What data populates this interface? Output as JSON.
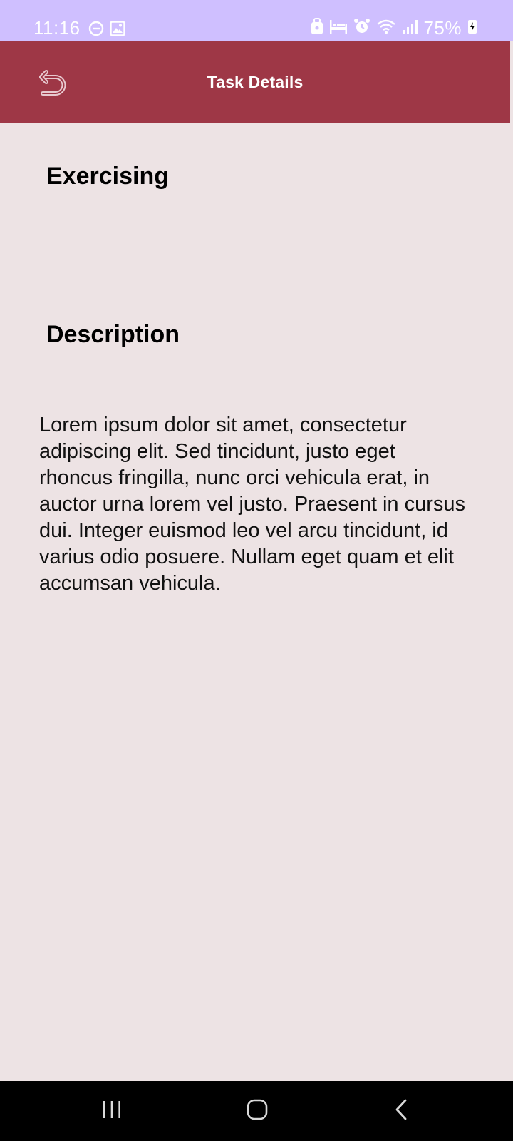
{
  "status_bar": {
    "time": "11:16",
    "battery_percent": "75%",
    "left_icons": [
      "do-not-disturb-icon",
      "image-icon"
    ],
    "right_icons": [
      "lock-icon",
      "bed-icon",
      "alarm-icon",
      "wifi-icon",
      "signal-icon",
      "battery-charging-icon"
    ],
    "background": "#cfbfff"
  },
  "app_bar": {
    "title": "Task Details",
    "back_icon": "back-arrow-icon",
    "background": "#9e3746"
  },
  "task": {
    "title": "Exercising",
    "description_heading": "Description",
    "description": "Lorem ipsum dolor sit amet, consectetur adipiscing elit. Sed tincidunt, justo eget rhoncus fringilla, nunc orci vehicula erat, in auctor urna lorem vel justo. Praesent in cursus dui. Integer euismod leo vel arcu tincidunt, id varius odio posuere. Nullam eget quam et elit accumsan vehicula."
  },
  "nav_bar": {
    "buttons": [
      "recent-apps-icon",
      "home-icon",
      "back-icon"
    ],
    "background": "#000000"
  },
  "colors": {
    "page_background": "#ede3e4"
  }
}
